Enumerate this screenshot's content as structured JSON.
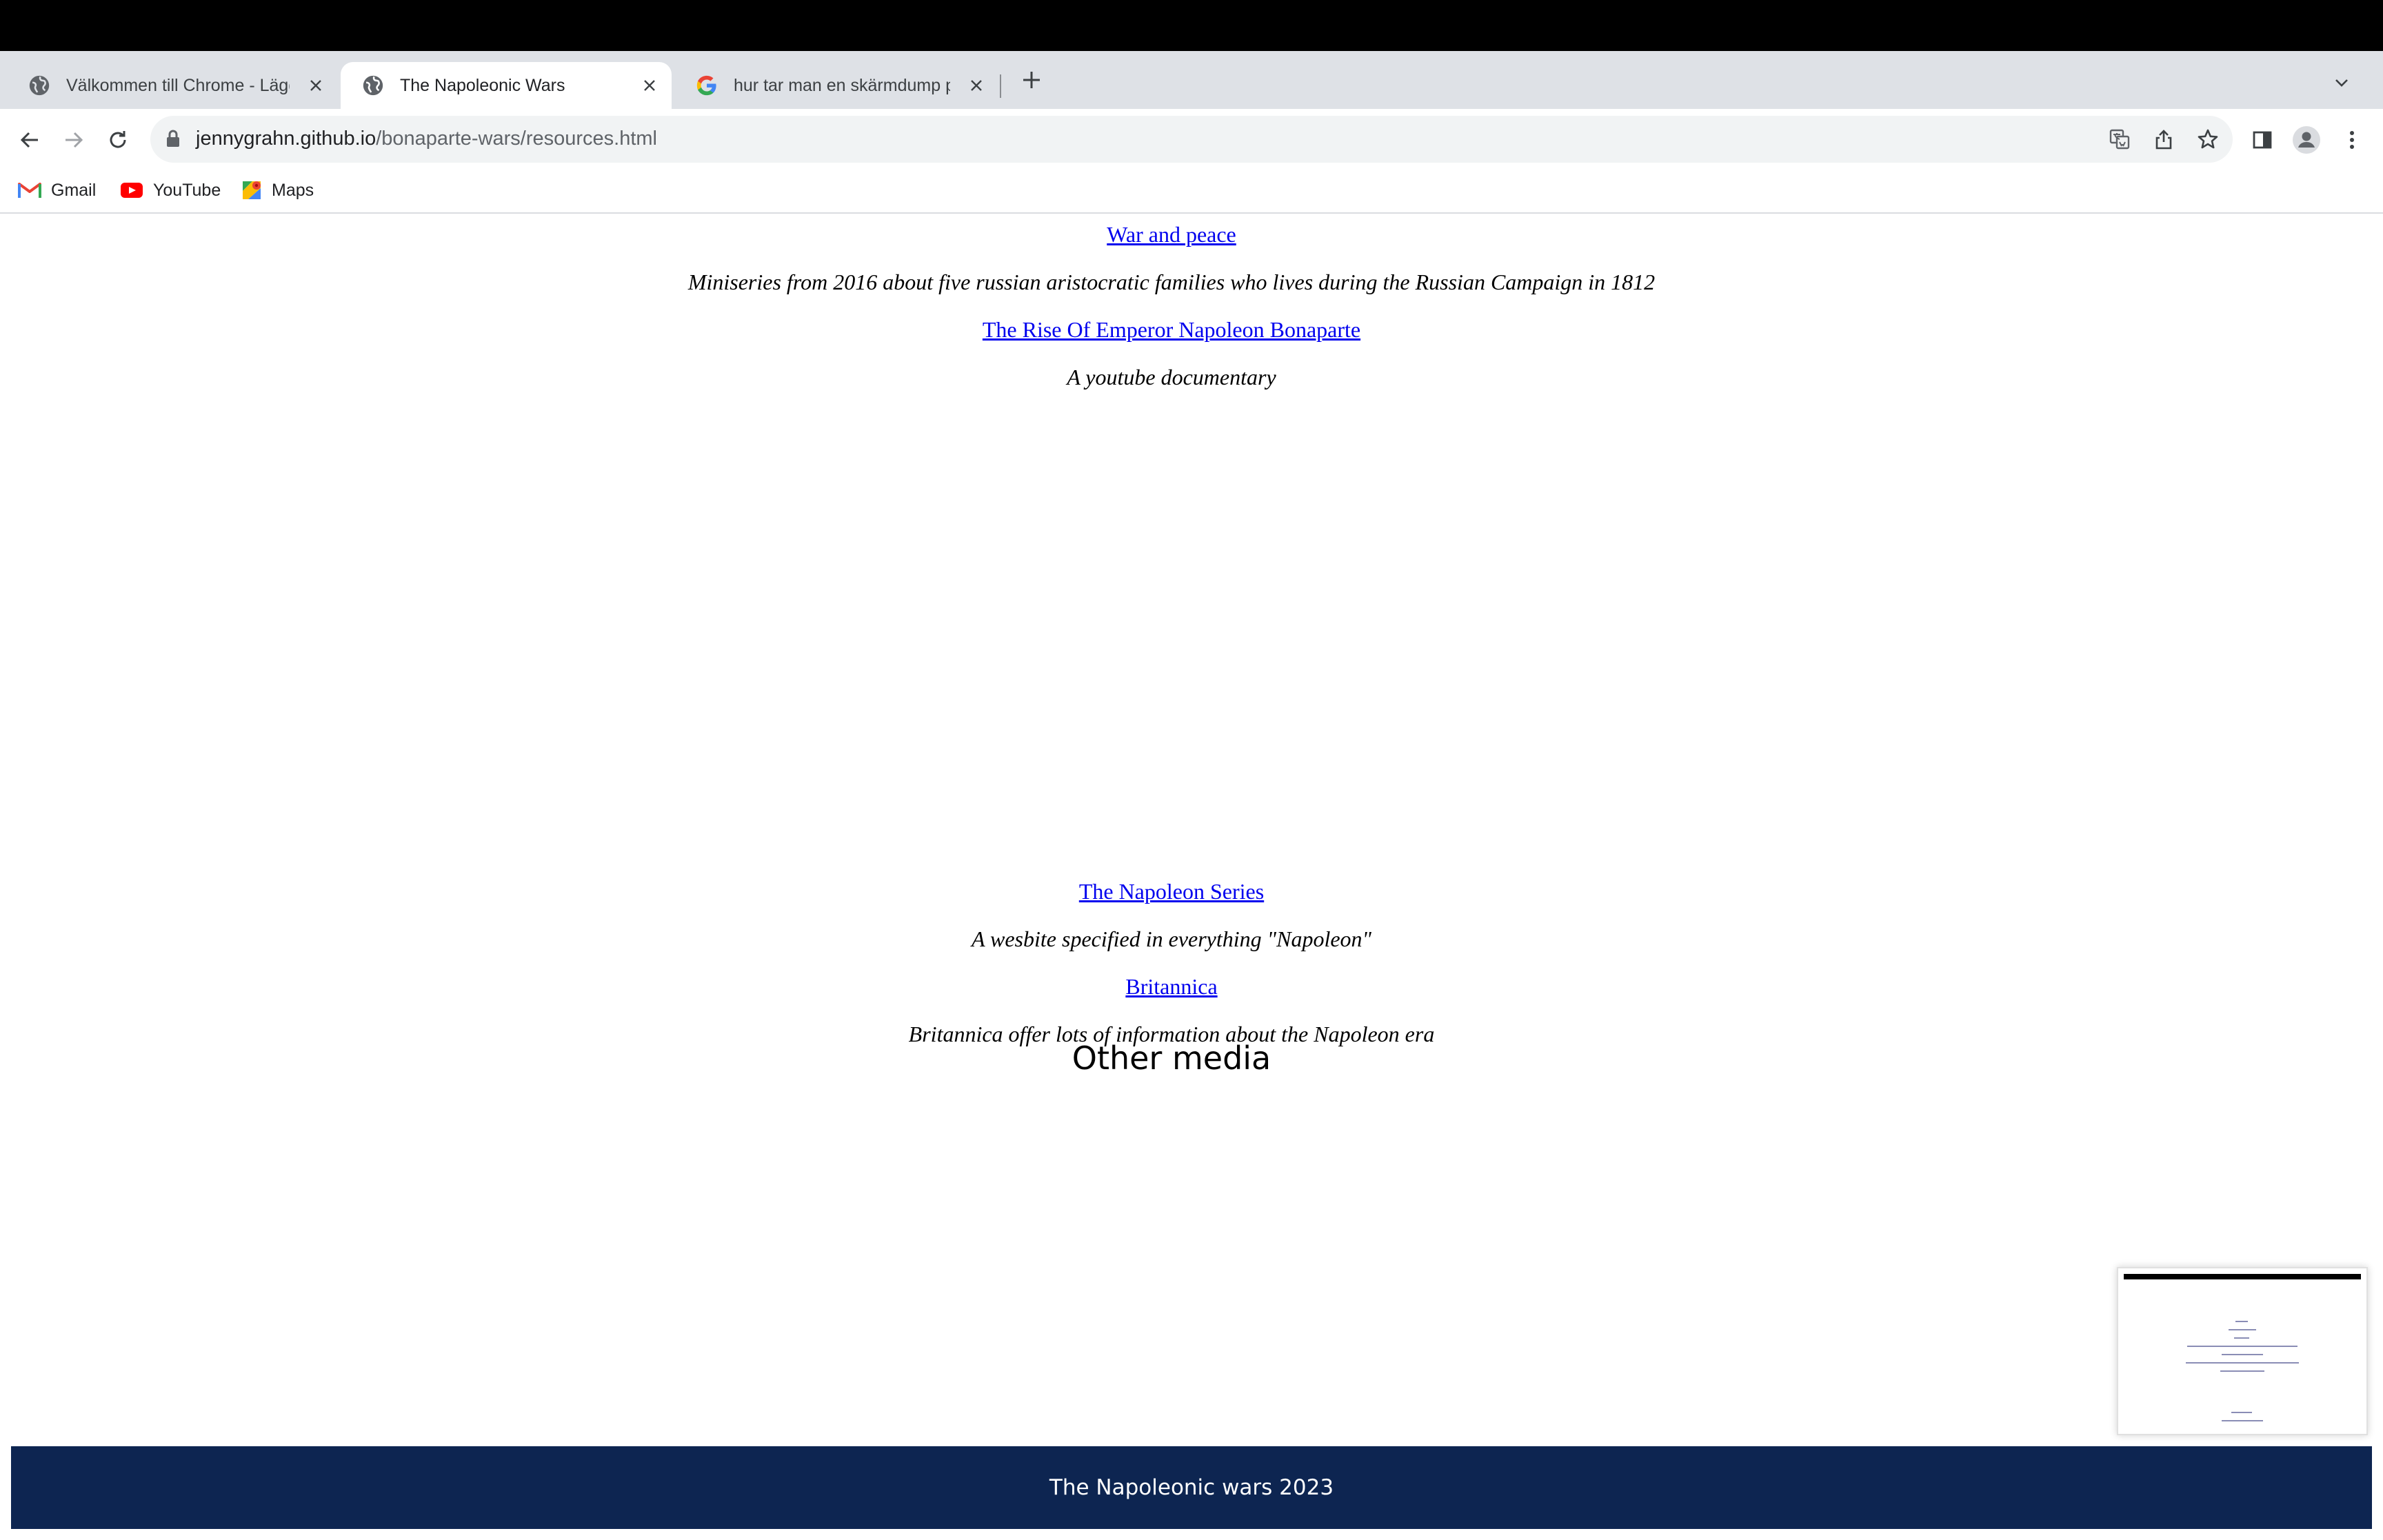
{
  "browser": {
    "tabs": [
      {
        "title": "Välkommen till Chrome - Lägg",
        "favicon": "globe-icon",
        "active": false
      },
      {
        "title": "The Napoleonic Wars",
        "favicon": "globe-icon",
        "active": true
      },
      {
        "title": "hur tar man en skärmdump på",
        "favicon": "google-icon",
        "active": false
      }
    ],
    "url_host": "jennygrahn.github.io",
    "url_path": "/bonaparte-wars/resources.html",
    "bookmarks": [
      {
        "label": "Gmail",
        "icon": "gmail-icon"
      },
      {
        "label": "YouTube",
        "icon": "youtube-icon"
      },
      {
        "label": "Maps",
        "icon": "maps-icon"
      }
    ]
  },
  "page": {
    "series": [
      {
        "link": "War and peace",
        "description": "Miniseries from 2016 about five russian aristocratic families who lives during the Russian Campaign in 1812"
      },
      {
        "link": "The Rise Of Emperor Napoleon Bonaparte",
        "description": "A youtube documentary"
      }
    ],
    "other_media": {
      "heading": "Other media",
      "items": [
        {
          "link": "The Napoleon Series",
          "description": "A wesbite specified in everything \"Napoleon\""
        },
        {
          "link": "Britannica",
          "description": "Britannica offer lots of information about the Napoleon era"
        }
      ]
    },
    "footer": "The Napoleonic wars 2023"
  },
  "colors": {
    "footer_bg": "#0d2551",
    "link": "#0000ee",
    "tabstrip_bg": "#dee1e6"
  }
}
